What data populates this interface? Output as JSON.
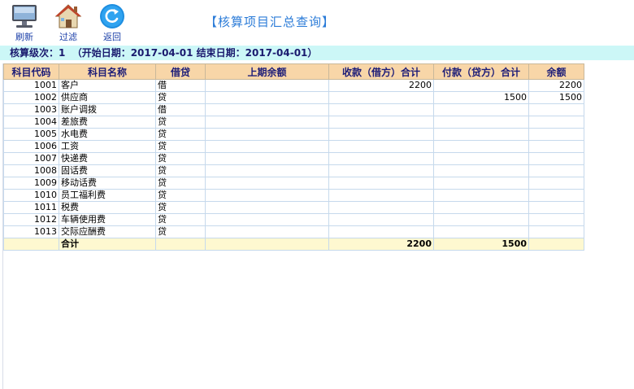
{
  "toolbar": {
    "refresh_label": "刷新",
    "filter_label": "过滤",
    "back_label": "返回"
  },
  "title": "【核算项目汇总查询】",
  "info": "核算级次：1  （开始日期：2017-04-01 结束日期：2017-04-01）",
  "table": {
    "headers": [
      "科目代码",
      "科目名称",
      "借贷",
      "上期余额",
      "收款（借方）合计",
      "付款（贷方）合计",
      "余额"
    ],
    "rows": [
      [
        "1001",
        "客户",
        "借",
        "",
        "2200",
        "",
        "2200"
      ],
      [
        "1002",
        "供应商",
        "贷",
        "",
        "",
        "1500",
        "1500"
      ],
      [
        "1003",
        "账户调拨",
        "借",
        "",
        "",
        "",
        ""
      ],
      [
        "1004",
        "差旅费",
        "贷",
        "",
        "",
        "",
        ""
      ],
      [
        "1005",
        "水电费",
        "贷",
        "",
        "",
        "",
        ""
      ],
      [
        "1006",
        "工资",
        "贷",
        "",
        "",
        "",
        ""
      ],
      [
        "1007",
        "快递费",
        "贷",
        "",
        "",
        "",
        ""
      ],
      [
        "1008",
        "固话费",
        "贷",
        "",
        "",
        "",
        ""
      ],
      [
        "1009",
        "移动话费",
        "贷",
        "",
        "",
        "",
        ""
      ],
      [
        "1010",
        "员工福利费",
        "贷",
        "",
        "",
        "",
        ""
      ],
      [
        "1011",
        "税费",
        "贷",
        "",
        "",
        "",
        ""
      ],
      [
        "1012",
        "车辆使用费",
        "贷",
        "",
        "",
        "",
        ""
      ],
      [
        "1013",
        "交际应酬费",
        "贷",
        "",
        "",
        "",
        ""
      ]
    ],
    "total": [
      "",
      "合计",
      "",
      "",
      "2200",
      "1500",
      ""
    ]
  },
  "colors": {
    "header_bg": "#f8d6a8",
    "info_bg": "#ccf7f7",
    "total_bg": "#fef8d0",
    "title": "#2c7cd8"
  },
  "icons": {
    "refresh": "monitor-icon",
    "filter": "house-icon",
    "back": "back-arrow-icon"
  }
}
